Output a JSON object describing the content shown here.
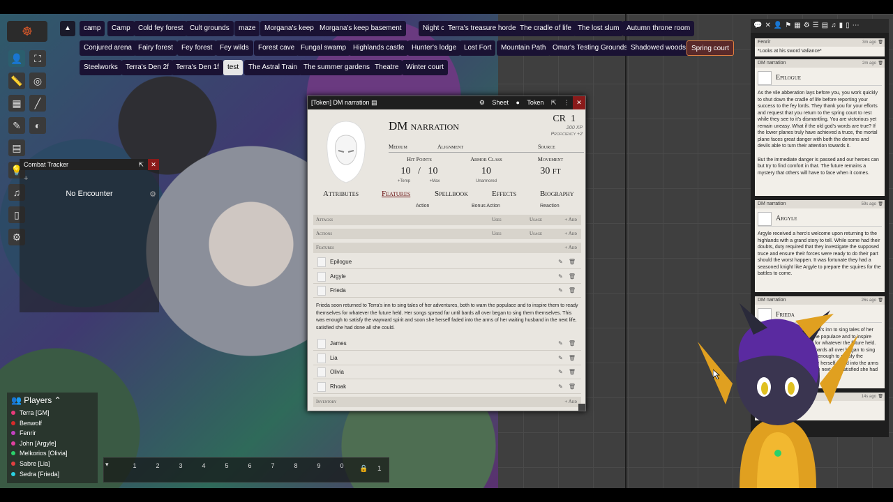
{
  "scenes": {
    "row1": [
      "camp",
      "Camp",
      "Cold fey forest",
      "Cult grounds",
      "maze",
      "Morgana's keep",
      "Morgana's keep basement",
      "Night camp",
      "Terra's treasure horde",
      "The cradle of life",
      "The lost slum",
      "Autumn throne room"
    ],
    "row2": [
      "Conjured arena",
      "Fairy forest",
      "Fey forest",
      "Fey wilds",
      "Forest cave",
      "Fungal swamp",
      "Highlands castle",
      "Hunter's lodge",
      "Lost Fort",
      "Mountain Path",
      "Omar's Testing Grounds",
      "Shadowed woods",
      "Spring court"
    ],
    "row3": [
      "Steelworks",
      "Terra's Den 2f",
      "Terra's Den 1f",
      "test",
      "The Astral Train",
      "The summer gardens",
      "Theatre",
      "Winter court"
    ]
  },
  "combat": {
    "title": "Combat Tracker",
    "add": "+",
    "empty": "No Encounter"
  },
  "players": {
    "title": "Players",
    "list": [
      {
        "name": "Terra [GM]",
        "color": "#e83a7a"
      },
      {
        "name": "Benwolf",
        "color": "#d62a2a"
      },
      {
        "name": "Fenrir",
        "color": "#c040c0"
      },
      {
        "name": "John [Argyle]",
        "color": "#e040a0"
      },
      {
        "name": "Melkorios [Olivia]",
        "color": "#2ad06a"
      },
      {
        "name": "Sabre [Lia]",
        "color": "#e04040"
      },
      {
        "name": "Sedra [Frieda]",
        "color": "#2ad0e0"
      }
    ]
  },
  "hotbar": {
    "slots": [
      "1",
      "2",
      "3",
      "4",
      "5",
      "6",
      "7",
      "8",
      "9",
      "0"
    ],
    "page": "1"
  },
  "sheet": {
    "title": "[Token] DM narration",
    "btn_sheet": "Sheet",
    "btn_token": "Token",
    "name": "DM narration",
    "cr_label": "CR",
    "cr_value": "1",
    "xp": "200 XP",
    "proficiency": "Proficiency +2",
    "size": "Medium",
    "alignment": "Alignment",
    "source": "Source",
    "hp_label": "Hit Points",
    "hp_value": "10",
    "hp_sep": "/",
    "hp_max": "10",
    "hp_temp": "+Temp",
    "hp_tmax": "+Max",
    "ac_label": "Armor Class",
    "ac_value": "10",
    "ac_sub": "Unarmored",
    "move_label": "Movement",
    "move_value": "30 ft",
    "tabs": [
      "Attributes",
      "Features",
      "Spellbook",
      "Effects",
      "Biography"
    ],
    "tab_subs": [
      "Action",
      "Bonus Action",
      "Reaction"
    ],
    "sections": {
      "attacks": "Attacks",
      "actions": "Actions",
      "features": "Features",
      "inventory": "Inventory",
      "uses": "Uses",
      "usage": "Usage",
      "add": "+ Add"
    },
    "features_top": [
      "Epilogue",
      "Argyle",
      "Frieda"
    ],
    "frieda_desc": "Frieda soon returned to Terra's inn to sing tales of her adventures, both to warn the populace and to inspire them to ready themselves for whatever the future held. Her songs spread far until bards all over began to sing them themselves. This was enough to satisfy the wayward spirit and soon she herself faded into the arms of her waiting husband in the next life, satisfied she had done all she could.",
    "features_bottom": [
      "James",
      "Lia",
      "Olivia",
      "Rhoak"
    ]
  },
  "chat": {
    "messages": [
      {
        "speaker": "Fenrir",
        "time": "3m ago",
        "text": "*Looks at his sword Valiance*"
      },
      {
        "speaker": "DM narration",
        "time": "2m ago",
        "title": "Epilogue",
        "text": "As the vile abberation lays before you, you work quickly to shut down the cradle of life before reporting your success to the fey lords. They thank you for your efforts and request that you return to the spring court to rest while they see to it's dismantling. You are victorious yet remain uneasy. What if the old god's words are true? If the lower planes truly have achieved a truce, the mortal plane faces great danger with both the demons and devils able to turn their attention towards it.",
        "text2": "But the immediate danger is passed and our heroes can but try to find comfort in that. The future remains a mystery that others will have to face when it comes."
      },
      {
        "speaker": "DM narration",
        "time": "59s ago",
        "title": "Argyle",
        "text": "Argyle received a hero's welcome upon returning to the highlands with a grand story to tell. While some had their doubts, duty required that they investigate the supposed truce and ensure their forces were ready to do their part should the worst happen. It was fortunate they had a seasoned knight like Argyle to prepare the squires for the battles to come."
      },
      {
        "speaker": "DM narration",
        "time": "26s ago",
        "title": "Frieda",
        "text": "Frieda soon returned to Terra's inn to sing tales of her adventures, both to warn the populace and to inspire them to ready themselves for whatever the future held. Her songs spread far until bards all over began to sing them themselves. This was enough to satisfy the wayward spirit and soon she herself faded into the arms of her waiting husband in the next life, satisfied she had done all she could."
      },
      {
        "speaker": "",
        "time": "14s ago",
        "text": ""
      }
    ]
  }
}
